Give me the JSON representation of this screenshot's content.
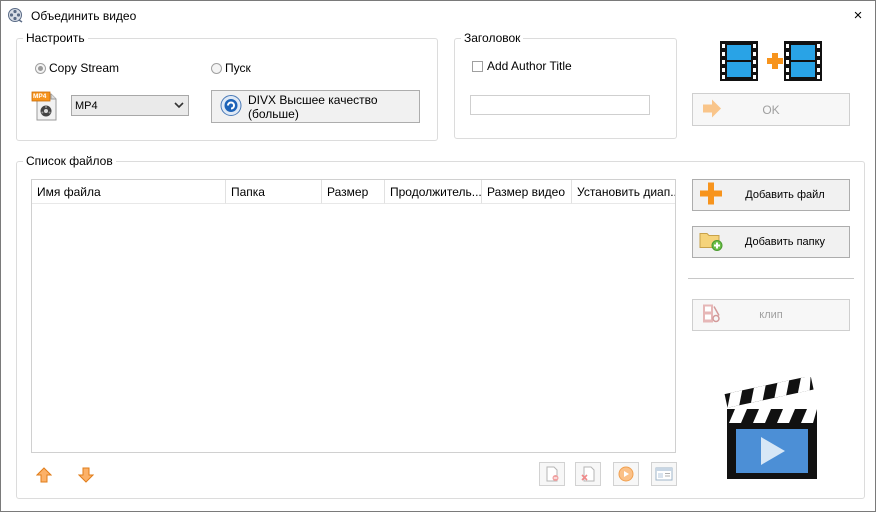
{
  "window": {
    "title": "Объединить видео",
    "close_label": "×"
  },
  "settings": {
    "group_label": "Настроить",
    "copy_stream_label": "Copy Stream",
    "copy_stream_checked": true,
    "start_label": "Пуск",
    "format_value": "MP4",
    "format_icon_text": "MP4",
    "quality_button_label": "DIVX Высшее качество (больше)"
  },
  "header": {
    "group_label": "Заголовок",
    "author_title_label": "Add Author Title",
    "author_title_checked": false,
    "title_value": ""
  },
  "actions": {
    "ok_label": "OK",
    "add_file_label": "Добавить файл",
    "add_folder_label": "Добавить папку",
    "clip_label": "клип"
  },
  "file_list": {
    "group_label": "Список файлов",
    "columns": [
      "Имя файла",
      "Папка",
      "Размер",
      "Продолжитель...",
      "Размер видео",
      "Установить диап..."
    ],
    "rows": []
  },
  "colors": {
    "accent_orange": "#f7941d",
    "film_blue": "#1e9fe0",
    "disabled_text": "#a0a0a0"
  }
}
